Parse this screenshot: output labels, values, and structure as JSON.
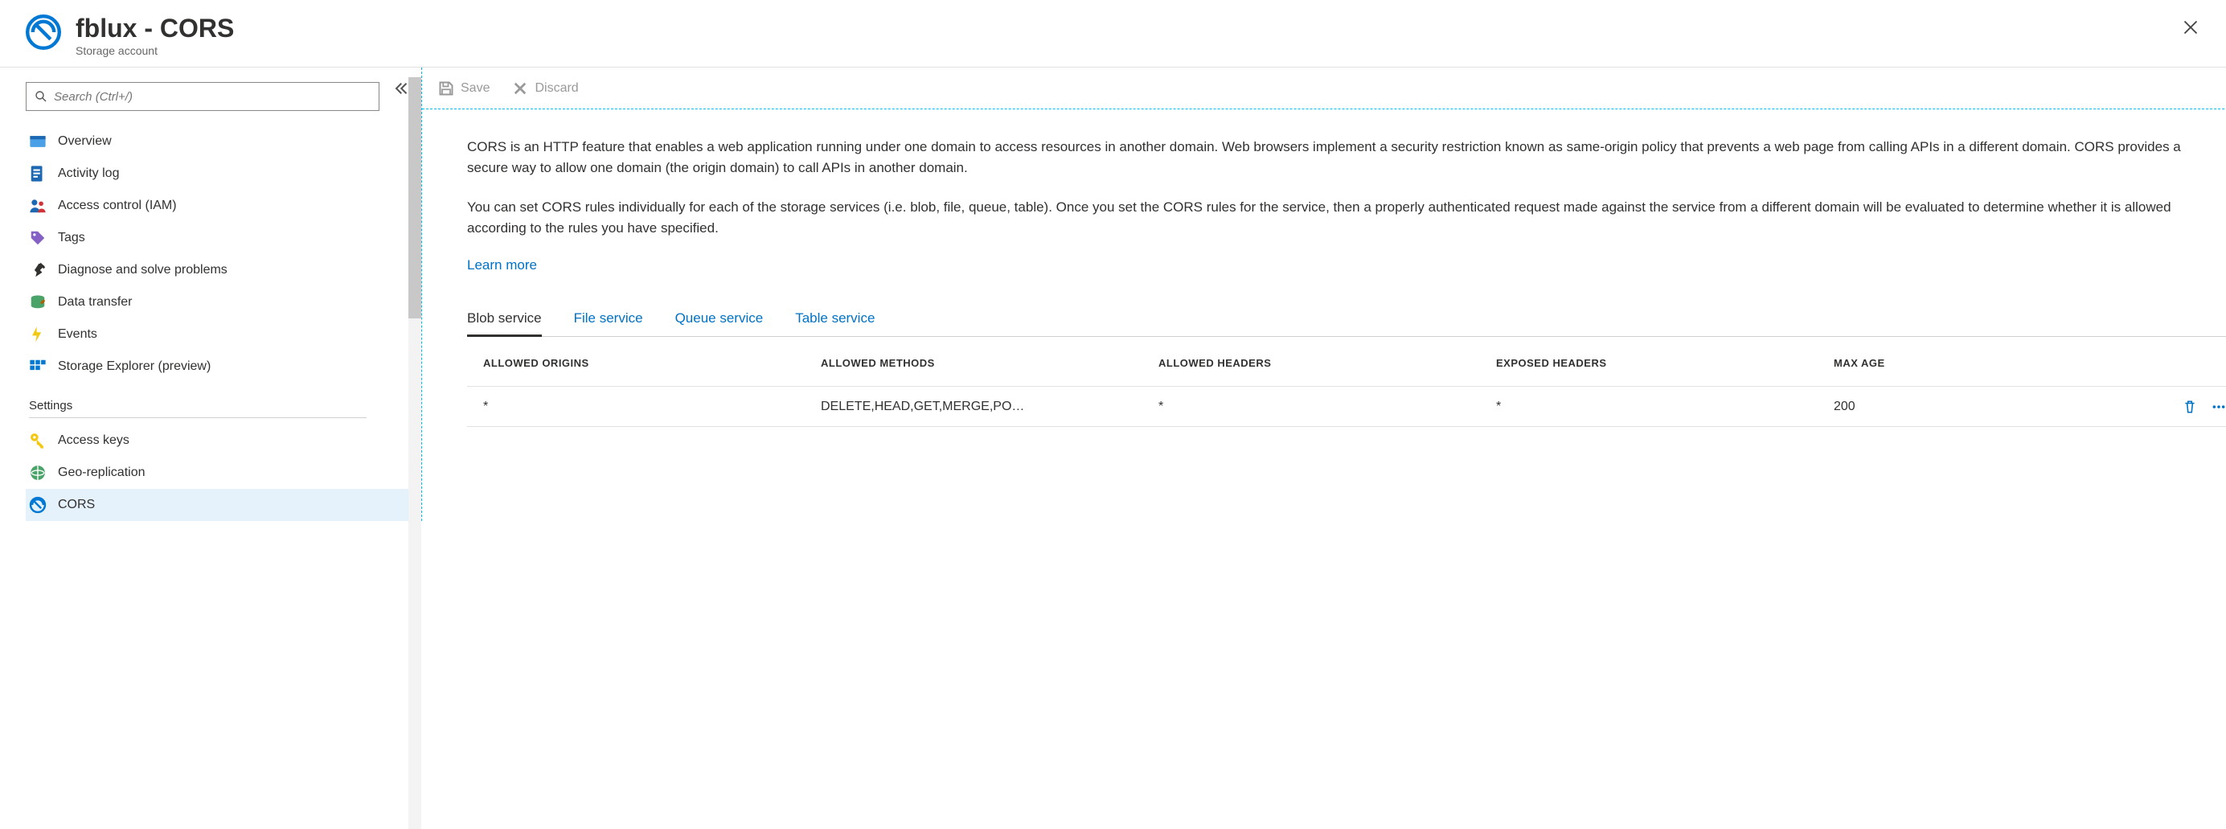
{
  "header": {
    "title": "fblux - CORS",
    "subtitle": "Storage account"
  },
  "search": {
    "placeholder": "Search (Ctrl+/)"
  },
  "nav": {
    "items": [
      {
        "label": "Overview"
      },
      {
        "label": "Activity log"
      },
      {
        "label": "Access control (IAM)"
      },
      {
        "label": "Tags"
      },
      {
        "label": "Diagnose and solve problems"
      },
      {
        "label": "Data transfer"
      },
      {
        "label": "Events"
      },
      {
        "label": "Storage Explorer (preview)"
      }
    ],
    "settings_heading": "Settings",
    "settings": [
      {
        "label": "Access keys"
      },
      {
        "label": "Geo-replication"
      },
      {
        "label": "CORS"
      }
    ]
  },
  "toolbar": {
    "save": "Save",
    "discard": "Discard"
  },
  "description": {
    "p1": "CORS is an HTTP feature that enables a web application running under one domain to access resources in another domain. Web browsers implement a security restriction known as same-origin policy that prevents a web page from calling APIs in a different domain. CORS provides a secure way to allow one domain (the origin domain) to call APIs in another domain.",
    "p2": "You can set CORS rules individually for each of the storage services (i.e. blob, file, queue, table). Once you set the CORS rules for the service, then a properly authenticated request made against the service from a different domain will be evaluated to determine whether it is allowed according to the rules you have specified.",
    "learn": "Learn more"
  },
  "tabs": {
    "blob": "Blob service",
    "file": "File service",
    "queue": "Queue service",
    "table": "Table service"
  },
  "table": {
    "headers": {
      "origins": "ALLOWED ORIGINS",
      "methods": "ALLOWED METHODS",
      "aheaders": "ALLOWED HEADERS",
      "eheaders": "EXPOSED HEADERS",
      "maxage": "MAX AGE"
    },
    "rows": [
      {
        "origins": "*",
        "methods": "DELETE,HEAD,GET,MERGE,PO…",
        "aheaders": "*",
        "eheaders": "*",
        "maxage": "200"
      }
    ]
  }
}
